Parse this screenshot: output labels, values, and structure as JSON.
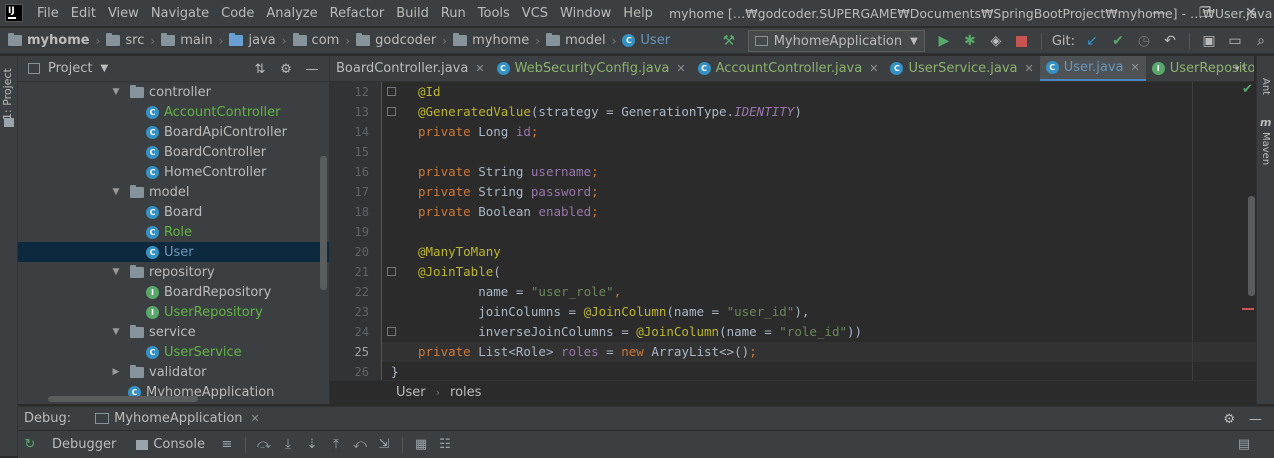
{
  "menu": [
    "File",
    "Edit",
    "View",
    "Navigate",
    "Code",
    "Analyze",
    "Refactor",
    "Build",
    "Run",
    "Tools",
    "VCS",
    "Window",
    "Help"
  ],
  "window_title": "myhome […₩godcoder.SUPERGAME₩Documents₩SpringBootProject₩myhome] - …₩User.java",
  "window_controls": {
    "minimize": "—",
    "restore": "❐",
    "close": "✕"
  },
  "breadcrumbs": [
    "myhome",
    "src",
    "main",
    "java",
    "com",
    "godcoder",
    "myhome",
    "model",
    "User"
  ],
  "run_config": "MyhomeApplication",
  "git_label": "Git:",
  "left_strip_label": "1: Project",
  "project_panel": {
    "title": "Project",
    "tree": [
      {
        "label": "controller",
        "kind": "pkg",
        "indent": 0,
        "expanded": true
      },
      {
        "label": "AccountController",
        "kind": "class",
        "color": "green",
        "indent": 1
      },
      {
        "label": "BoardApiController",
        "kind": "class",
        "color": "normal",
        "indent": 1
      },
      {
        "label": "BoardController",
        "kind": "class",
        "color": "normal",
        "indent": 1
      },
      {
        "label": "HomeController",
        "kind": "class",
        "color": "normal",
        "indent": 1
      },
      {
        "label": "model",
        "kind": "pkg",
        "indent": 0,
        "expanded": true
      },
      {
        "label": "Board",
        "kind": "class",
        "color": "normal",
        "indent": 1
      },
      {
        "label": "Role",
        "kind": "class",
        "color": "green",
        "indent": 1
      },
      {
        "label": "User",
        "kind": "class",
        "color": "green",
        "indent": 1,
        "selected": true
      },
      {
        "label": "repository",
        "kind": "pkg",
        "indent": 0,
        "expanded": true
      },
      {
        "label": "BoardRepository",
        "kind": "interface",
        "color": "normal",
        "indent": 1
      },
      {
        "label": "UserRepository",
        "kind": "interface",
        "color": "green",
        "indent": 1
      },
      {
        "label": "service",
        "kind": "pkg",
        "indent": 0,
        "expanded": true
      },
      {
        "label": "UserService",
        "kind": "class",
        "color": "green",
        "indent": 1
      },
      {
        "label": "validator",
        "kind": "pkg",
        "indent": 0,
        "expanded": false
      },
      {
        "label": "MyhomeApplication",
        "kind": "app",
        "color": "normal",
        "indent": 0
      }
    ]
  },
  "editor_tabs": [
    {
      "label": "BoardController.java",
      "icon": "none",
      "color": "normal",
      "active": false
    },
    {
      "label": "WebSecurityConfig.java",
      "icon": "class",
      "color": "green",
      "active": false
    },
    {
      "label": "AccountController.java",
      "icon": "class",
      "color": "green",
      "active": false
    },
    {
      "label": "UserService.java",
      "icon": "class",
      "color": "green",
      "active": false
    },
    {
      "label": "User.java",
      "icon": "class",
      "color": "blue",
      "active": true
    },
    {
      "label": "UserRepository.java",
      "icon": "interface",
      "color": "green",
      "active": false
    }
  ],
  "tab_overflow": "⁵",
  "right_strip": {
    "ant": "Ant",
    "maven": "Maven"
  },
  "line_numbers": [
    "12",
    "13",
    "14",
    "15",
    "16",
    "17",
    "18",
    "19",
    "20",
    "21",
    "22",
    "23",
    "24",
    "25",
    "26"
  ],
  "current_line": "25",
  "code_lines": [
    [
      {
        "t": "@Id",
        "c": "ann"
      }
    ],
    [
      {
        "t": "@GeneratedValue",
        "c": "ann"
      },
      {
        "t": "(strategy = GenerationType.",
        "c": ""
      },
      {
        "t": "IDENTITY",
        "c": "ital"
      },
      {
        "t": ")",
        "c": ""
      }
    ],
    [
      {
        "t": "private ",
        "c": "kw"
      },
      {
        "t": "Long ",
        "c": ""
      },
      {
        "t": "id",
        "c": "fld"
      },
      {
        "t": ";",
        "c": "kw"
      }
    ],
    [],
    [
      {
        "t": "private ",
        "c": "kw"
      },
      {
        "t": "String ",
        "c": ""
      },
      {
        "t": "username",
        "c": "fld"
      },
      {
        "t": ";",
        "c": "kw"
      }
    ],
    [
      {
        "t": "private ",
        "c": "kw"
      },
      {
        "t": "String ",
        "c": ""
      },
      {
        "t": "password",
        "c": "fld"
      },
      {
        "t": ";",
        "c": "kw"
      }
    ],
    [
      {
        "t": "private ",
        "c": "kw"
      },
      {
        "t": "Boolean ",
        "c": ""
      },
      {
        "t": "enabled",
        "c": "fld"
      },
      {
        "t": ";",
        "c": "kw"
      }
    ],
    [],
    [
      {
        "t": "@ManyToMany",
        "c": "ann"
      }
    ],
    [
      {
        "t": "@JoinTable",
        "c": "ann"
      },
      {
        "t": "(",
        "c": ""
      }
    ],
    [
      {
        "t": "        name = ",
        "c": ""
      },
      {
        "t": "\"user_role\"",
        "c": "str"
      },
      {
        "t": ",",
        "c": "kw"
      }
    ],
    [
      {
        "t": "        joinColumns = ",
        "c": ""
      },
      {
        "t": "@JoinColumn",
        "c": "ann"
      },
      {
        "t": "(name = ",
        "c": ""
      },
      {
        "t": "\"user_id\"",
        "c": "str"
      },
      {
        "t": "),",
        "c": ""
      }
    ],
    [
      {
        "t": "        inverseJoinColumns = ",
        "c": ""
      },
      {
        "t": "@JoinColumn",
        "c": "ann"
      },
      {
        "t": "(name = ",
        "c": ""
      },
      {
        "t": "\"role_id\"",
        "c": "str"
      },
      {
        "t": "))",
        "c": ""
      }
    ],
    [
      {
        "t": "private ",
        "c": "kw"
      },
      {
        "t": "List<Role> ",
        "c": ""
      },
      {
        "t": "roles",
        "c": "fld"
      },
      {
        "t": " = ",
        "c": ""
      },
      {
        "t": "new ",
        "c": "kw"
      },
      {
        "t": "ArrayList<>()",
        "c": ""
      },
      {
        "t": ";",
        "c": "kw"
      }
    ],
    [
      {
        "t": "}",
        "c": ""
      }
    ]
  ],
  "editor_breadcrumbs": [
    "User",
    "roles"
  ],
  "debug": {
    "label": "Debug:",
    "session": "MyhomeApplication",
    "tabs": [
      "Debugger",
      "Console"
    ]
  }
}
